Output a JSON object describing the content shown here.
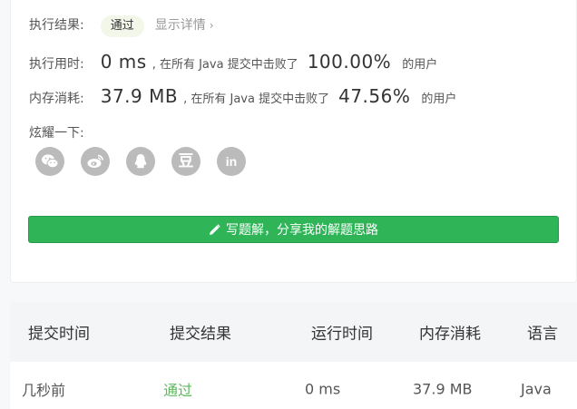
{
  "result": {
    "label": "执行结果:",
    "status": "通过",
    "details_link": "显示详情",
    "chevron": "›"
  },
  "runtime": {
    "label": "执行用时:",
    "value": "0 ms",
    "text_before": ", 在所有 Java 提交中击败了",
    "percent": "100.00%",
    "text_after": "的用户"
  },
  "memory": {
    "label": "内存消耗:",
    "value": "37.9 MB",
    "text_before": ", 在所有 Java 提交中击败了",
    "percent": "47.56%",
    "text_after": "的用户"
  },
  "share": {
    "label": "炫耀一下:",
    "icons": [
      "wechat-icon",
      "weibo-icon",
      "qq-icon",
      "douban-icon",
      "linkedin-icon"
    ],
    "douban_glyph": "豆",
    "linkedin_glyph": "in"
  },
  "write_button": {
    "label": "写题解，分享我的解题思路"
  },
  "table": {
    "headers": [
      "提交时间",
      "提交结果",
      "运行时间",
      "内存消耗",
      "语言"
    ],
    "rows": [
      [
        "几秒前",
        "通过",
        "0 ms",
        "37.9 MB",
        "Java"
      ]
    ]
  },
  "colors": {
    "accent_green": "#2fb457",
    "success_text": "#5cb85c",
    "icon_gray": "#bbbbbb"
  }
}
